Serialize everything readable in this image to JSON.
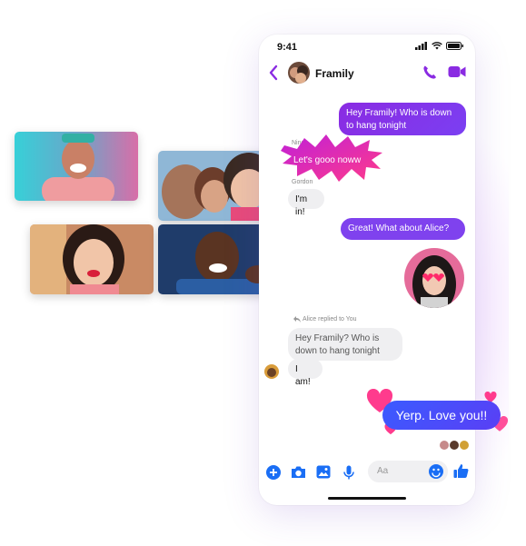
{
  "status": {
    "time": "9:41"
  },
  "chat": {
    "title": "Framily"
  },
  "messages": {
    "m1": "Hey Framily! Who is down to hang tonight",
    "ning_name": "Ning",
    "m2": "Let's gooo noww",
    "gordon_name": "Gordon",
    "m3": "I'm in!",
    "m4": "Great! What about Alice?",
    "reply_note": "Alice replied to You",
    "quoted": "Hey Framily? Who is down to hang tonight",
    "m5": "I am!",
    "m6": "Yerp. Love you!!"
  },
  "composer": {
    "placeholder": "Aa"
  },
  "colors": {
    "accent": "#7b3ff2",
    "blue": "#3b5bff",
    "pink": "#ff3b8d"
  },
  "icons": [
    "back-chevron-icon",
    "phone-icon",
    "video-camera-icon",
    "plus-icon",
    "camera-icon",
    "gallery-icon",
    "microphone-icon",
    "emoji-icon",
    "thumbs-up-icon"
  ]
}
